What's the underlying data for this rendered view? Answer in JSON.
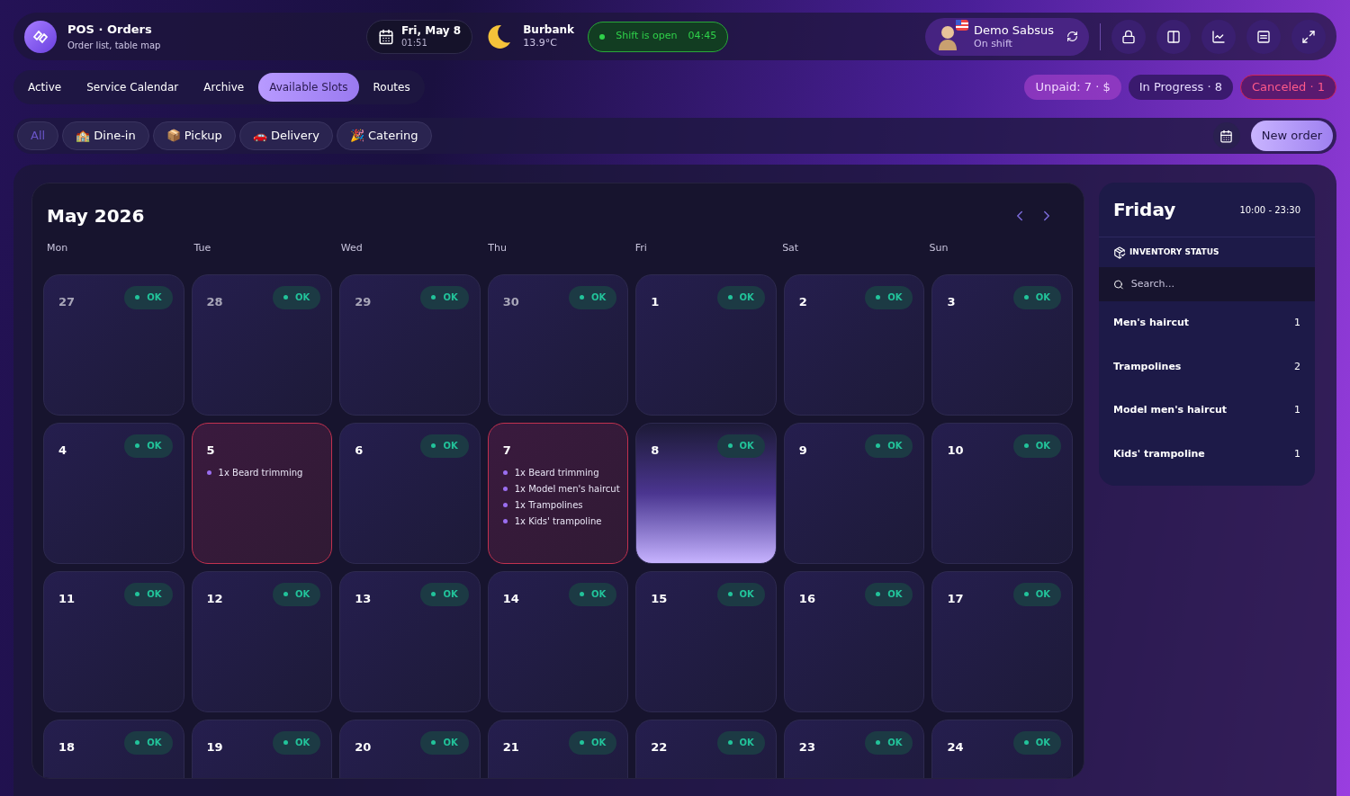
{
  "header": {
    "title": "POS · Orders",
    "subtitle": "Order list, table map",
    "date": "Fri, May 8",
    "time": "01:51",
    "city": "Burbank",
    "temperature": "13.9°C",
    "shift": {
      "open": true,
      "label": "Shift is open",
      "timer": "04:45"
    },
    "user": {
      "name": "Demo Sabsus",
      "status": "On shift"
    }
  },
  "tabs": [
    {
      "label": "Active",
      "selected": false
    },
    {
      "label": "Service Calendar",
      "selected": false
    },
    {
      "label": "Archive",
      "selected": false
    },
    {
      "label": "Available Slots",
      "selected": true
    },
    {
      "label": "Routes",
      "selected": false
    }
  ],
  "status_chips": [
    {
      "label": "Unpaid: 7 · $",
      "kind": "unpaid"
    },
    {
      "label": "In Progress · 8",
      "kind": "progress"
    },
    {
      "label": "Canceled · 1",
      "kind": "canceled"
    }
  ],
  "filters": [
    {
      "label": "All",
      "selected": true
    },
    {
      "emoji": "🏫",
      "label": "Dine-in",
      "selected": false
    },
    {
      "emoji": "📦",
      "label": "Pickup",
      "selected": false
    },
    {
      "emoji": "🚗",
      "label": "Delivery",
      "selected": false
    },
    {
      "emoji": "🎉",
      "label": "Catering",
      "selected": false
    }
  ],
  "new_order": "New order",
  "calendar": {
    "title": "May 2026",
    "weekdays": [
      "Mon",
      "Tue",
      "Wed",
      "Thu",
      "Fri",
      "Sat",
      "Sun"
    ],
    "weeks": [
      [
        {
          "day": "27",
          "muted": true,
          "booked": false,
          "today": false,
          "status": "OK"
        },
        {
          "day": "28",
          "muted": true,
          "booked": false,
          "today": false,
          "status": "OK"
        },
        {
          "day": "29",
          "muted": true,
          "booked": false,
          "today": false,
          "status": "OK"
        },
        {
          "day": "30",
          "muted": true,
          "booked": false,
          "today": false,
          "status": "OK"
        },
        {
          "day": "1",
          "muted": false,
          "booked": false,
          "today": false,
          "status": "OK"
        },
        {
          "day": "2",
          "muted": false,
          "booked": false,
          "today": false,
          "status": "OK"
        },
        {
          "day": "3",
          "muted": false,
          "booked": false,
          "today": false,
          "status": "OK"
        }
      ],
      [
        {
          "day": "4",
          "muted": false,
          "booked": false,
          "today": false,
          "status": "OK"
        },
        {
          "day": "5",
          "muted": false,
          "booked": true,
          "today": false,
          "items": [
            "1x Beard trimming"
          ]
        },
        {
          "day": "6",
          "muted": false,
          "booked": false,
          "today": false,
          "status": "OK"
        },
        {
          "day": "7",
          "muted": false,
          "booked": true,
          "today": false,
          "items": [
            "1x Beard trimming",
            "1x Model men's haircut",
            "1x Trampolines",
            "1x Kids' trampoline"
          ]
        },
        {
          "day": "8",
          "muted": false,
          "booked": false,
          "today": true,
          "status": "OK"
        },
        {
          "day": "9",
          "muted": false,
          "booked": false,
          "today": false,
          "status": "OK"
        },
        {
          "day": "10",
          "muted": false,
          "booked": false,
          "today": false,
          "status": "OK"
        }
      ],
      [
        {
          "day": "11",
          "muted": false,
          "booked": false,
          "today": false,
          "status": "OK"
        },
        {
          "day": "12",
          "muted": false,
          "booked": false,
          "today": false,
          "status": "OK"
        },
        {
          "day": "13",
          "muted": false,
          "booked": false,
          "today": false,
          "status": "OK"
        },
        {
          "day": "14",
          "muted": false,
          "booked": false,
          "today": false,
          "status": "OK"
        },
        {
          "day": "15",
          "muted": false,
          "booked": false,
          "today": false,
          "status": "OK"
        },
        {
          "day": "16",
          "muted": false,
          "booked": false,
          "today": false,
          "status": "OK"
        },
        {
          "day": "17",
          "muted": false,
          "booked": false,
          "today": false,
          "status": "OK"
        }
      ],
      [
        {
          "day": "18",
          "muted": false,
          "booked": false,
          "today": false,
          "status": "OK"
        },
        {
          "day": "19",
          "muted": false,
          "booked": false,
          "today": false,
          "status": "OK"
        },
        {
          "day": "20",
          "muted": false,
          "booked": false,
          "today": false,
          "status": "OK"
        },
        {
          "day": "21",
          "muted": false,
          "booked": false,
          "today": false,
          "status": "OK"
        },
        {
          "day": "22",
          "muted": false,
          "booked": false,
          "today": false,
          "status": "OK"
        },
        {
          "day": "23",
          "muted": false,
          "booked": false,
          "today": false,
          "status": "OK"
        },
        {
          "day": "24",
          "muted": false,
          "booked": false,
          "today": false,
          "status": "OK"
        }
      ]
    ]
  },
  "side_panel": {
    "day": "Friday",
    "hours": "10:00 - 23:30",
    "section": "INVENTORY STATUS",
    "search_placeholder": "Search...",
    "items": [
      {
        "name": "Men's haircut",
        "count": "1"
      },
      {
        "name": "Trampolines",
        "count": "2"
      },
      {
        "name": "Model men's haircut",
        "count": "1"
      },
      {
        "name": "Kids' trampoline",
        "count": "1"
      }
    ]
  }
}
